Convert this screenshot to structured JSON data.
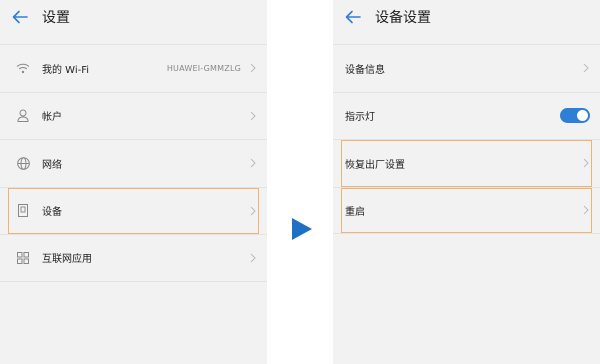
{
  "left_screen": {
    "title": "设置",
    "items": [
      {
        "label": "我的 Wi-Fi",
        "value": "HUAWEI-GMMZLG",
        "icon": "wifi-icon"
      },
      {
        "label": "帐户",
        "icon": "user-icon"
      },
      {
        "label": "网络",
        "icon": "globe-icon"
      },
      {
        "label": "设备",
        "icon": "device-icon",
        "highlighted": true
      },
      {
        "label": "互联网应用",
        "icon": "apps-grid-icon"
      }
    ]
  },
  "right_screen": {
    "title": "设备设置",
    "items": [
      {
        "label": "设备信息"
      },
      {
        "label": "指示灯",
        "toggle_on": true
      },
      {
        "label": "恢复出厂设置",
        "highlighted": true
      },
      {
        "label": "重启",
        "highlighted": true
      }
    ]
  },
  "colors": {
    "accent": "#2f7fd6",
    "highlight_border": "#f0b470",
    "arrow": "#1f6fc4",
    "background": "#f2f2f2"
  }
}
